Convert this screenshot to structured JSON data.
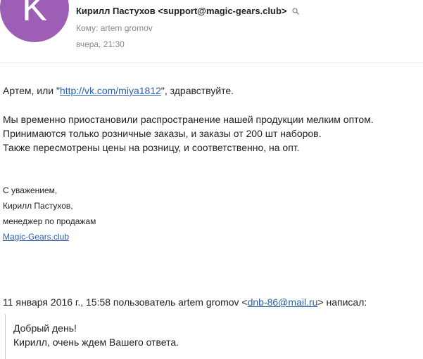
{
  "header": {
    "avatar_letter": "K",
    "avatar_color": "#9c5fb5",
    "sender": "Кирилл Пастухов <support@magic-gears.club>",
    "to_label": "Кому:",
    "to_name": "artem gromov",
    "date": "вчера, 21:30"
  },
  "body": {
    "greeting_prefix": "Артем, или \"",
    "greeting_link": "http://vk.com/miya1812",
    "greeting_suffix": "\", здравствуйте.",
    "paragraph_lines": [
      "Мы временно приостановили распространение нашей продукции мелким оптом.",
      "Принимаются только розничные заказы, и заказы от 200 шт наборов.",
      "Также пересмотрены цены на розницу, и соответственно, на опт."
    ]
  },
  "signature": {
    "regards": "С уважением,",
    "name": "Кирилл Пастухов,",
    "role": "менеджер по продажам",
    "site": "Magic-Gears.club"
  },
  "quote": {
    "intro_prefix": "11 января 2016 г., 15:58 пользователь artem gromov <",
    "intro_email": "dnb-86@mail.ru",
    "intro_suffix": "> написал:",
    "lines": [
      "Добрый день!",
      "Кирилл, очень ждем Вашего ответа."
    ]
  }
}
